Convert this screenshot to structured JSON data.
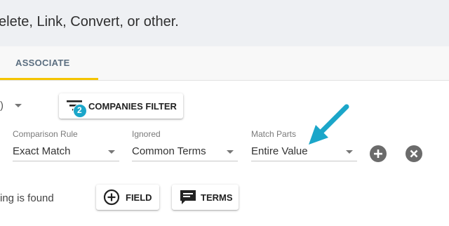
{
  "banner": {
    "text": "elete, Link, Convert, or other."
  },
  "tabs": {
    "associate": "ASSOCIATE"
  },
  "toolbar": {
    "partial_select_fragment": ")",
    "companies_filter_label": "COMPANIES FILTER",
    "companies_filter_badge": "2"
  },
  "rule_fields": {
    "comparison": {
      "label": "Comparison Rule",
      "value": "Exact Match"
    },
    "ignored": {
      "label": "Ignored",
      "value": "Common Terms"
    },
    "match_parts": {
      "label": "Match Parts",
      "value": "Entire Value"
    }
  },
  "actions": {
    "status_text": "ing is found",
    "field_button_label": "FIELD",
    "terms_button_label": "TERMS"
  },
  "colors": {
    "tab_underline": "#f5c400",
    "badge": "#1ba6c9",
    "arrow": "#1ba6c9",
    "round_button": "#6b6b6b"
  },
  "icons": [
    "filter-icon",
    "add-circle-icon",
    "remove-circle-icon",
    "comment-icon",
    "arrow-annotation-icon"
  ]
}
